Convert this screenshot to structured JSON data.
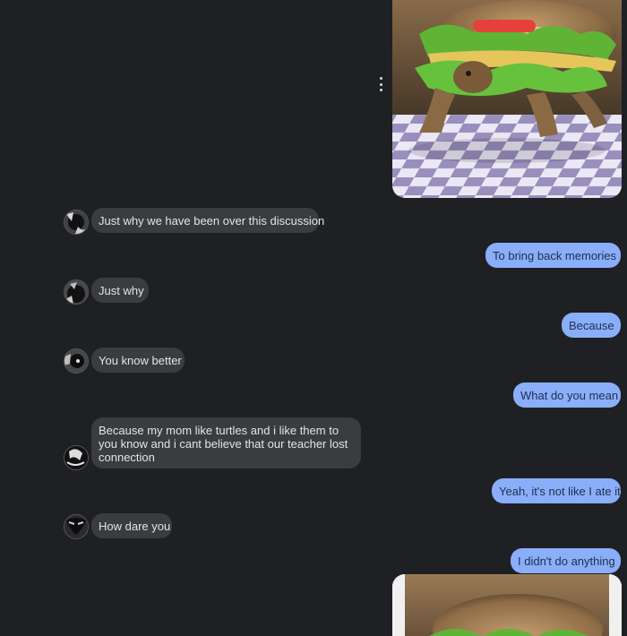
{
  "chat": {
    "received": [
      {
        "text": "Just why we have been over this discussion"
      },
      {
        "text": "Just why"
      },
      {
        "text": "You know better"
      },
      {
        "text": "Because my mom like turtles and i like them to you know and i cant believe that our teacher lost connection"
      },
      {
        "text": "How dare you"
      }
    ],
    "sent": [
      {
        "text": "To bring back memories"
      },
      {
        "text": "Because"
      },
      {
        "text": "What do you mean"
      },
      {
        "text": "Yeah, it's not like I ate it"
      },
      {
        "text": "I didn't do anything"
      }
    ],
    "images": [
      {
        "description": "turtle-burger-photo"
      },
      {
        "description": "turtle-burger-photo"
      }
    ]
  },
  "colors": {
    "background": "#1f2023",
    "received_bubble": "#3a3c40",
    "sent_bubble": "#8aaef9",
    "received_text": "#e4e4e6",
    "sent_text": "#1f2f4d"
  },
  "icons": {
    "more": "more-vert-icon"
  }
}
